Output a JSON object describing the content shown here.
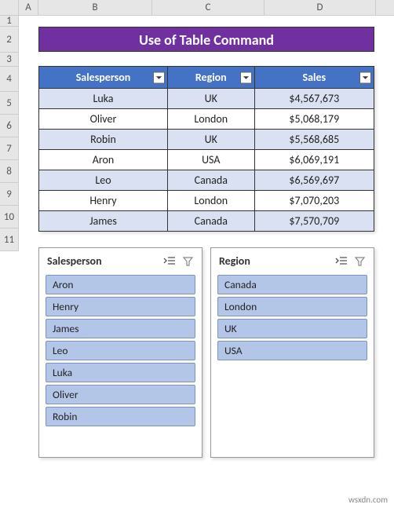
{
  "columns": [
    "",
    "A",
    "B",
    "C",
    "D"
  ],
  "rows": [
    "1",
    "2",
    "3",
    "4",
    "5",
    "6",
    "7",
    "8",
    "9",
    "10",
    "11"
  ],
  "title": "Use of Table Command",
  "table": {
    "headers": [
      "Salesperson",
      "Region",
      "Sales"
    ],
    "data": [
      {
        "salesperson": "Luka",
        "region": "UK",
        "sales": "$4,567,673",
        "banded": true
      },
      {
        "salesperson": "Oliver",
        "region": "London",
        "sales": "$5,068,179",
        "banded": false
      },
      {
        "salesperson": "Robin",
        "region": "UK",
        "sales": "$5,568,685",
        "banded": true
      },
      {
        "salesperson": "Aron",
        "region": "USA",
        "sales": "$6,069,191",
        "banded": false
      },
      {
        "salesperson": "Leo",
        "region": "Canada",
        "sales": "$6,569,697",
        "banded": true
      },
      {
        "salesperson": "Henry",
        "region": "London",
        "sales": "$7,070,203",
        "banded": false
      },
      {
        "salesperson": "James",
        "region": "Canada",
        "sales": "$7,570,709",
        "banded": true
      }
    ]
  },
  "slicers": [
    {
      "title": "Salesperson",
      "items": [
        "Aron",
        "Henry",
        "James",
        "Leo",
        "Luka",
        "Oliver",
        "Robin"
      ]
    },
    {
      "title": "Region",
      "items": [
        "Canada",
        "London",
        "UK",
        "USA"
      ]
    }
  ],
  "watermark": "wsxdn.com"
}
